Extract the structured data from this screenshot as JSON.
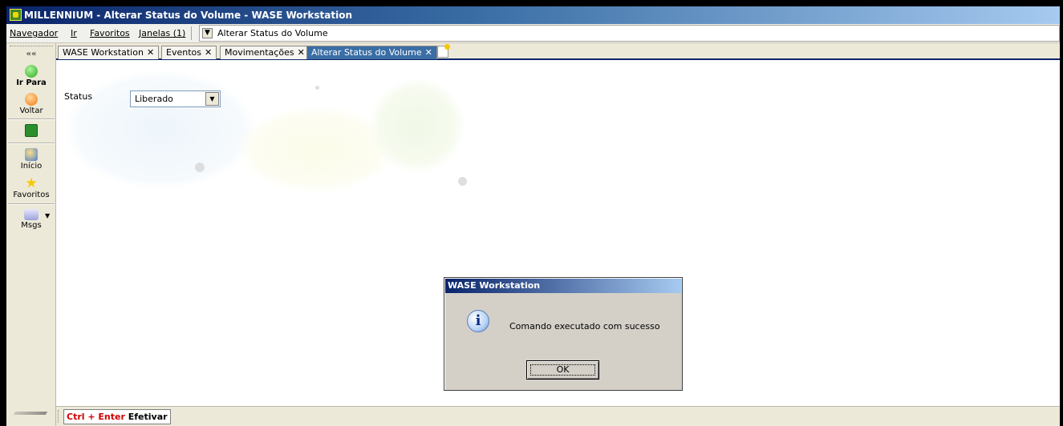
{
  "window": {
    "title": "MILLENNIUM - Alterar Status do Volume - WASE Workstation"
  },
  "menubar": {
    "items": [
      {
        "label": "Navegador"
      },
      {
        "label": "Ir"
      },
      {
        "label": "Favoritos"
      },
      {
        "label": "Janelas (1)"
      }
    ],
    "address_text": "Alterar Status do Volume"
  },
  "sidebar": {
    "collapse_label": "««",
    "buttons": [
      {
        "label": "Ir Para",
        "icon": "go-icon"
      },
      {
        "label": "Voltar",
        "icon": "back-icon"
      },
      {
        "label": "",
        "icon": "refresh-icon"
      },
      {
        "label": "Início",
        "icon": "home-icon"
      },
      {
        "label": "Favoritos",
        "icon": "star-icon"
      },
      {
        "label": "Msgs",
        "icon": "mail-icon"
      }
    ]
  },
  "tabs": [
    {
      "label": "WASE Workstation",
      "close": "✕",
      "active": false
    },
    {
      "label": "Eventos",
      "close": "✕",
      "active": false
    },
    {
      "label": "Movimentações",
      "close": "✕",
      "active": false
    },
    {
      "label": "Alterar Status do Volume",
      "close": "✕",
      "active": true
    }
  ],
  "form": {
    "status_label": "Status",
    "status_value": "Liberado"
  },
  "footer": {
    "shortcut_key": "Ctrl + Enter",
    "shortcut_action": "Efetivar"
  },
  "dialog": {
    "title": "WASE Workstation",
    "message": "Comando executado com sucesso",
    "ok_label": "OK",
    "icon": "info-icon"
  },
  "colors": {
    "titlebar_start": "#0a246a",
    "titlebar_end": "#a6caf0",
    "accent_shortcut": "#d00000",
    "active_tab": "#3a6ea5"
  }
}
